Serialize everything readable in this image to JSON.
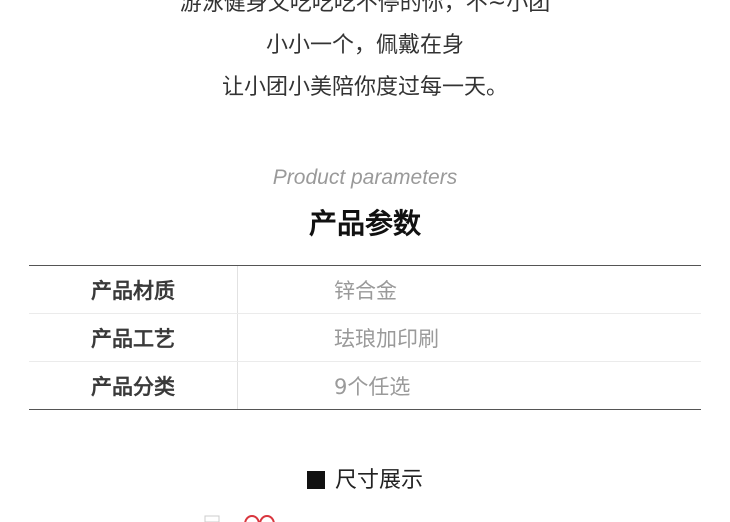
{
  "intro": {
    "lines": [
      "游泳健身又吃吃吃不停的你，不~小团",
      "小小一个，佩戴在身",
      "让小团小美陪你度过每一天。"
    ]
  },
  "params": {
    "title_en": "Product parameters",
    "title_cn": "产品参数",
    "rows": [
      {
        "label": "产品材质",
        "value": "锌合金"
      },
      {
        "label": "产品工艺",
        "value": "珐琅加印刷"
      },
      {
        "label": "产品分类",
        "value": "9个任选"
      }
    ]
  },
  "size_section": {
    "title": "尺寸展示",
    "marker_color": "#111111",
    "preview_color": "#d9363e"
  }
}
